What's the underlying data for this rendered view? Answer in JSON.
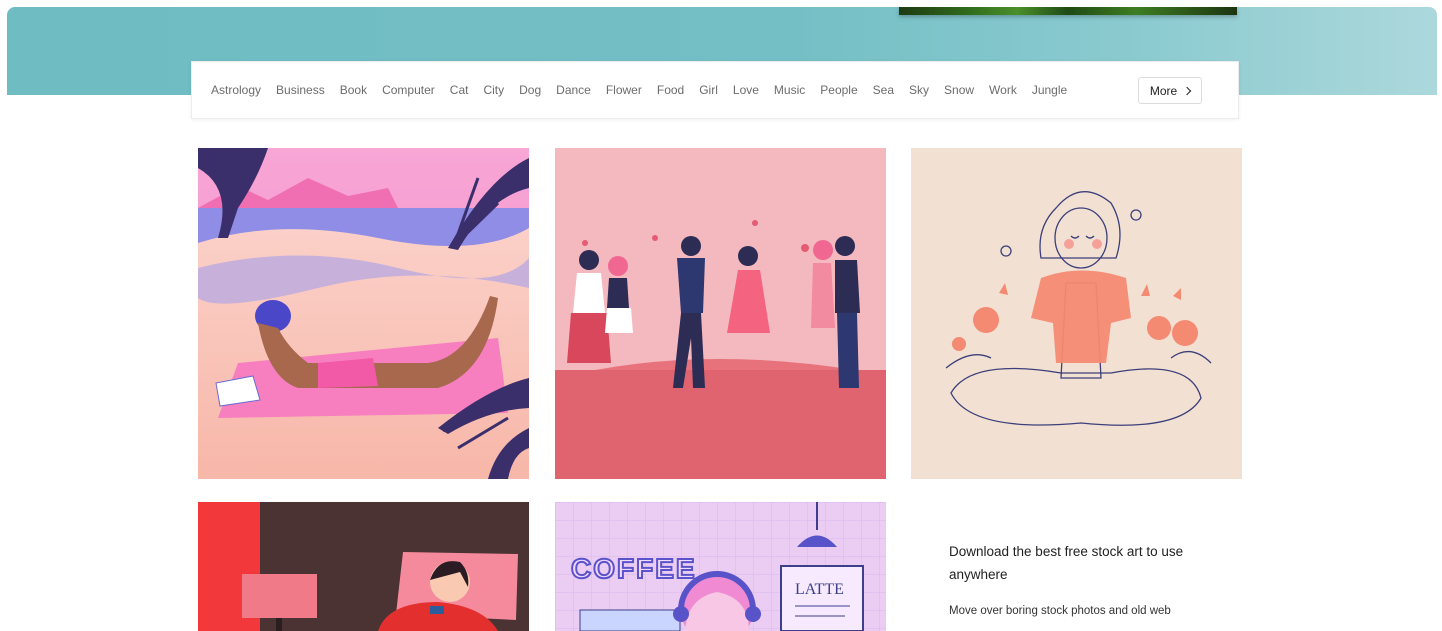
{
  "categories": [
    "Astrology",
    "Business",
    "Book",
    "Computer",
    "Cat",
    "City",
    "Dog",
    "Dance",
    "Flower",
    "Food",
    "Girl",
    "Love",
    "Music",
    "People",
    "Sea",
    "Sky",
    "Snow",
    "Work",
    "Jungle"
  ],
  "more_label": "More",
  "promo": {
    "title": "Download the best free stock art to use anywhere",
    "body": "Move over boring stock photos and old web"
  },
  "tile_text": {
    "coffee": "COFFEE",
    "latte": "LATTE"
  }
}
